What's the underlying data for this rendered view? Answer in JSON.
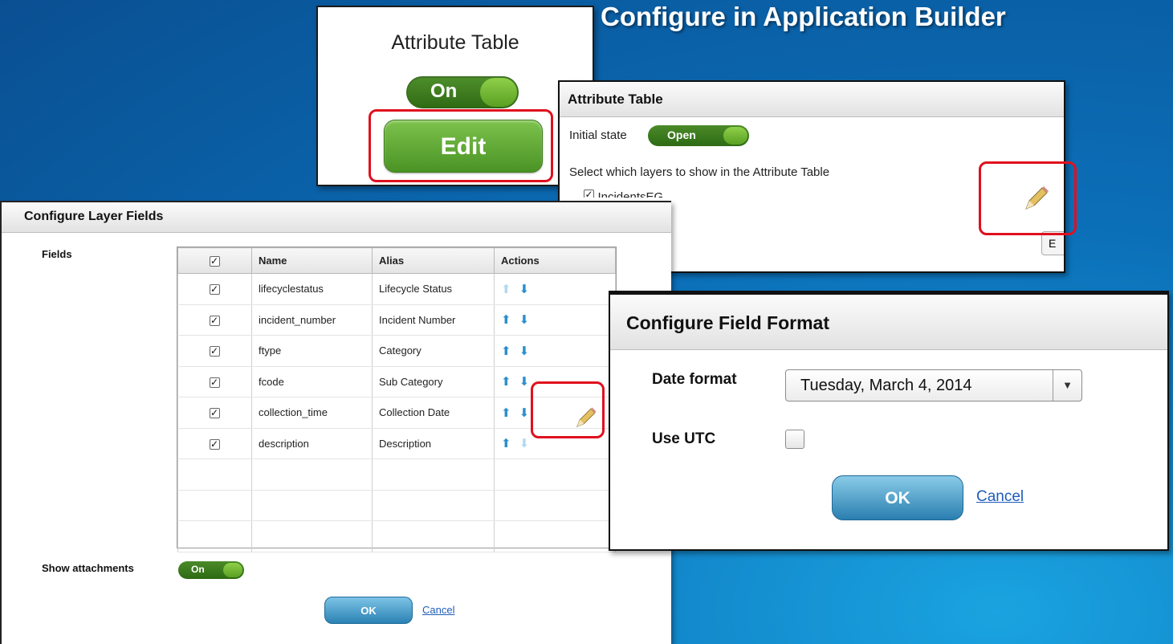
{
  "slide": {
    "title": "Configure in Application Builder"
  },
  "widget": {
    "title": "Attribute Table",
    "toggle_label": "On",
    "edit_label": "Edit"
  },
  "attribute_panel": {
    "title": "Attribute Table",
    "initial_state_label": "Initial state",
    "initial_state_value": "Open",
    "instruction": "Select which layers to show in the Attribute Table",
    "layer": "IncidentsEG",
    "clipped_button_label": "E"
  },
  "layer_fields": {
    "title": "Configure Layer Fields",
    "fields_label": "Fields",
    "columns": [
      "Name",
      "Alias",
      "Actions"
    ],
    "rows": [
      {
        "name": "lifecyclestatus",
        "alias": "Lifecycle Status"
      },
      {
        "name": "incident_number",
        "alias": "Incident Number"
      },
      {
        "name": "ftype",
        "alias": "Category"
      },
      {
        "name": "fcode",
        "alias": "Sub Category"
      },
      {
        "name": "collection_time",
        "alias": "Collection Date"
      },
      {
        "name": "description",
        "alias": "Description"
      }
    ],
    "show_attachments_label": "Show attachments",
    "show_attachments_value": "On",
    "ok_label": "OK",
    "cancel_label": "Cancel"
  },
  "field_format": {
    "title": "Configure Field Format",
    "date_format_label": "Date format",
    "date_format_value": "Tuesday, March 4, 2014",
    "utc_label": "Use UTC",
    "ok_label": "OK",
    "cancel_label": "Cancel"
  },
  "colors": {
    "highlight": "#e0101e",
    "toggle_green": "#2f6a14",
    "button_blue": "#2a7fb0",
    "background": "#0b6fb8"
  },
  "icons": [
    "pencil-icon",
    "arrow-up-icon",
    "arrow-down-icon",
    "checkbox-icon",
    "dropdown-caret-icon"
  ]
}
